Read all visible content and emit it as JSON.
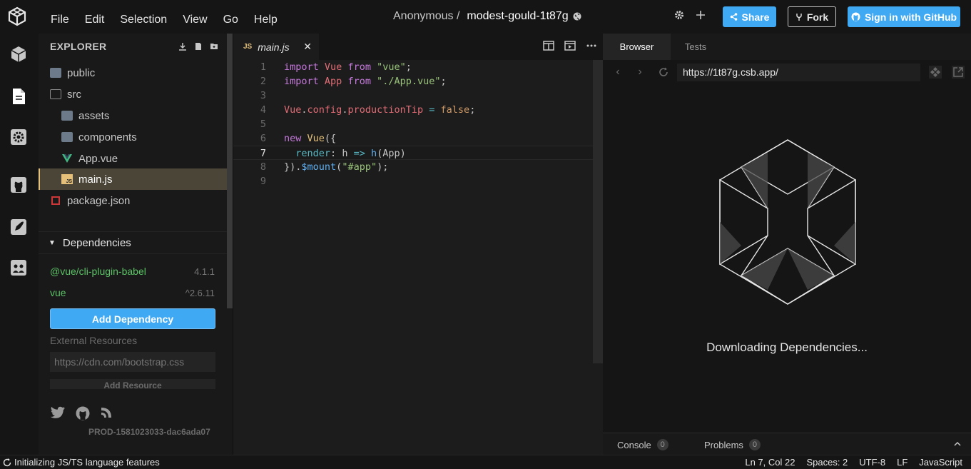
{
  "menu": [
    "File",
    "Edit",
    "Selection",
    "View",
    "Go",
    "Help"
  ],
  "header": {
    "owner": "Anonymous /",
    "sandbox_name": "modest-gould-1t87g",
    "share_label": "Share",
    "fork_label": "Fork",
    "github_label": "Sign in with GitHub"
  },
  "explorer": {
    "title": "EXPLORER",
    "tree": [
      {
        "name": "public",
        "type": "folder",
        "depth": 0
      },
      {
        "name": "src",
        "type": "folder-open",
        "depth": 0
      },
      {
        "name": "assets",
        "type": "folder",
        "depth": 1
      },
      {
        "name": "components",
        "type": "folder",
        "depth": 1
      },
      {
        "name": "App.vue",
        "type": "vue",
        "depth": 1
      },
      {
        "name": "main.js",
        "type": "js",
        "depth": 1,
        "active": true
      },
      {
        "name": "package.json",
        "type": "package",
        "depth": 0
      }
    ]
  },
  "dependencies": {
    "title": "Dependencies",
    "items": [
      {
        "name": "@vue/cli-plugin-babel",
        "version": "4.1.1"
      },
      {
        "name": "vue",
        "version": "^2.6.11"
      }
    ],
    "add_label": "Add Dependency",
    "external_label": "External Resources",
    "external_placeholder": "https://cdn.com/bootstrap.css",
    "add_resource_label": "Add Resource",
    "build_id": "PROD-1581023033-dac6ada07"
  },
  "editor": {
    "tab_icon": "JS",
    "tab_label": "main.js",
    "current_line": 7
  },
  "preview": {
    "tabs": [
      "Browser",
      "Tests"
    ],
    "url": "https://1t87g.csb.app/",
    "loading_text": "Downloading Dependencies...",
    "console_label": "Console",
    "console_count": "0",
    "problems_label": "Problems",
    "problems_count": "0"
  },
  "status": {
    "left": "Initializing JS/TS language features",
    "position": "Ln 7, Col 22",
    "spaces": "Spaces: 2",
    "encoding": "UTF-8",
    "eol": "LF",
    "language": "JavaScript"
  },
  "colors": {
    "accent": "#40a9f3",
    "dependency_name": "#5bc266",
    "active_file_border": "#e5c07b"
  }
}
